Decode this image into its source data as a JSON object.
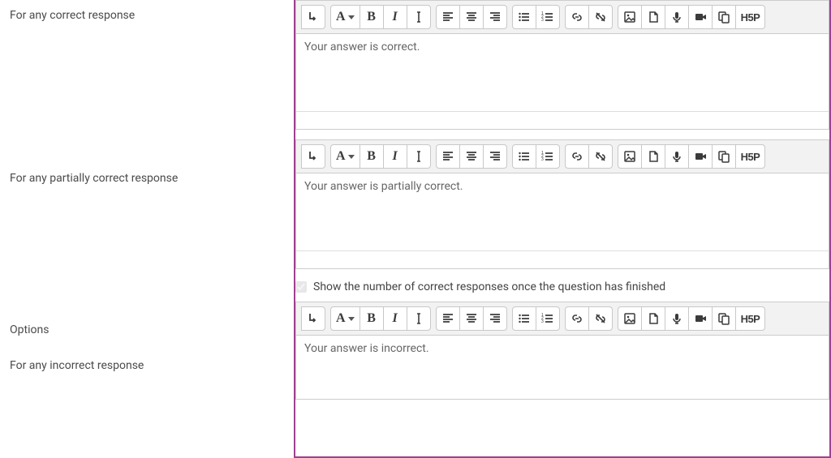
{
  "labels": {
    "correct": "For any correct response",
    "partial": "For any partially correct response",
    "options": "Options",
    "incorrect": "For any incorrect response"
  },
  "editors": {
    "correct": {
      "content": "Your answer is correct."
    },
    "partial": {
      "content": "Your answer is partially correct."
    },
    "incorrect": {
      "content": "Your answer is incorrect."
    }
  },
  "options": {
    "show_count_label": "Show the number of correct responses once the question has finished",
    "show_count_checked": true
  },
  "h5p": "H5P"
}
